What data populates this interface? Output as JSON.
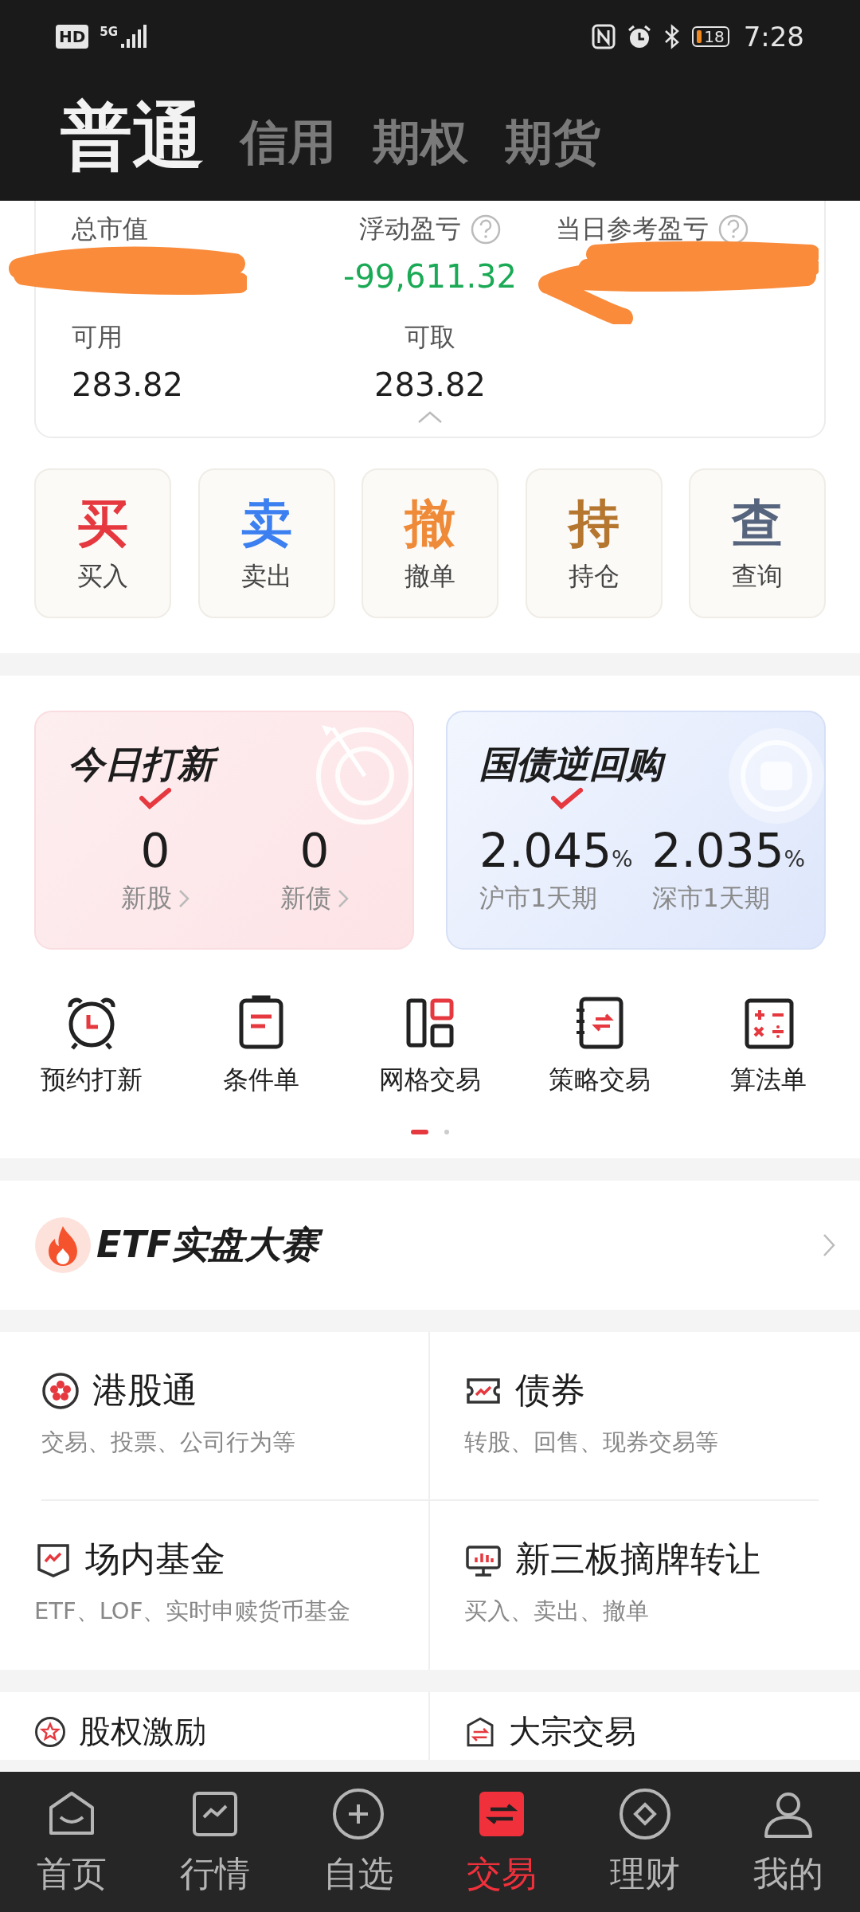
{
  "status_bar": {
    "hd": "HD",
    "network": "5G",
    "battery": "18",
    "time": "7:28"
  },
  "account_tabs": [
    {
      "label": "普通",
      "selected": true
    },
    {
      "label": "信用",
      "selected": false
    },
    {
      "label": "期权",
      "selected": false
    },
    {
      "label": "期货",
      "selected": false
    }
  ],
  "summary": {
    "row_1": [
      {
        "label": "总市值",
        "help": false,
        "redacted": true
      },
      {
        "label": "浮动盈亏",
        "help": true,
        "value": "-99,611.32",
        "color": "#1aaa55"
      },
      {
        "label": "当日参考盈亏",
        "help": true,
        "redacted": true
      }
    ],
    "row_2": [
      {
        "label": "可用",
        "value": "283.82"
      },
      {
        "label": "可取",
        "value": "283.82"
      }
    ]
  },
  "actions": [
    {
      "glyph": "买",
      "label": "买入",
      "color": "#e5393f"
    },
    {
      "glyph": "卖",
      "label": "卖出",
      "color": "#3b7ff0"
    },
    {
      "glyph": "撤",
      "label": "撤单",
      "color": "#ef8a38"
    },
    {
      "glyph": "持",
      "label": "持仓",
      "color": "#b5762f"
    },
    {
      "glyph": "查",
      "label": "查询",
      "color": "#56647e"
    }
  ],
  "promos": [
    {
      "kind": "ipo",
      "title": "今日打新",
      "stats": [
        {
          "value": "0",
          "label": "新股",
          "link": true
        },
        {
          "value": "0",
          "label": "新债",
          "link": true
        }
      ]
    },
    {
      "kind": "repo",
      "title": "国债逆回购",
      "stats": [
        {
          "value": "2.045",
          "unit": "%",
          "label": "沪市1天期",
          "link": false
        },
        {
          "value": "2.035",
          "unit": "%",
          "label": "深市1天期",
          "link": false
        }
      ]
    }
  ],
  "tools": [
    {
      "kind": "alarm",
      "label": "预约打新"
    },
    {
      "kind": "clipboard",
      "label": "条件单"
    },
    {
      "kind": "grid",
      "label": "网格交易"
    },
    {
      "kind": "notebook",
      "label": "策略交易"
    },
    {
      "kind": "calculator",
      "label": "算法单"
    }
  ],
  "tool_pages": [
    {
      "selected": true
    },
    {
      "selected": false
    }
  ],
  "banner": {
    "title": "ETF实盘大赛"
  },
  "services": [
    {
      "kind": "hk",
      "title": "港股通",
      "subtitle": "交易、投票、公司行为等"
    },
    {
      "kind": "bond",
      "title": "债券",
      "subtitle": "转股、回售、现券交易等"
    },
    {
      "kind": "fund",
      "title": "场内基金",
      "subtitle": "ETF、LOF、实时申赎货币基金"
    },
    {
      "kind": "board",
      "title": "新三板摘牌转让",
      "subtitle": "买入、卖出、撤单"
    }
  ],
  "services_more": [
    {
      "kind": "star",
      "title": "股权激励"
    },
    {
      "kind": "exchange",
      "title": "大宗交易"
    }
  ],
  "nav": [
    {
      "kind": "home",
      "label": "首页",
      "selected": false
    },
    {
      "kind": "chart",
      "label": "行情",
      "selected": false
    },
    {
      "kind": "plus",
      "label": "自选",
      "selected": false
    },
    {
      "kind": "trade",
      "label": "交易",
      "selected": true
    },
    {
      "kind": "finance",
      "label": "理财",
      "selected": false
    },
    {
      "kind": "user",
      "label": "我的",
      "selected": false
    }
  ]
}
